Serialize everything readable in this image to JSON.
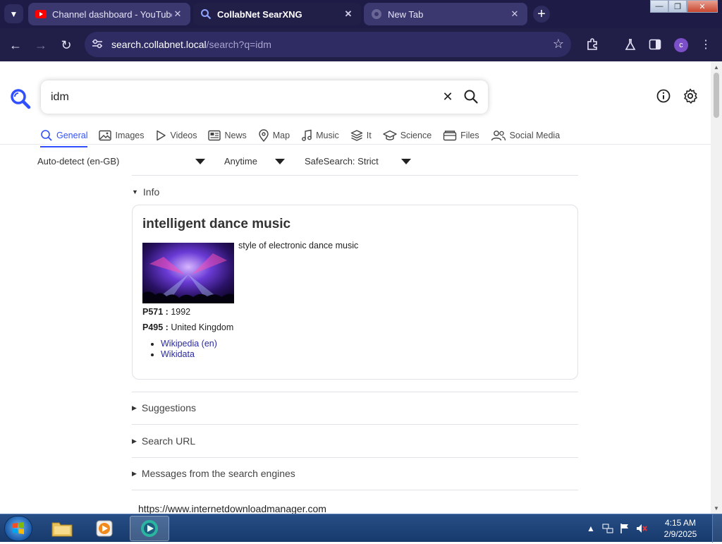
{
  "browser": {
    "tabs": [
      {
        "title": "Channel dashboard - YouTube",
        "favicon": "youtube-icon"
      },
      {
        "title": "CollabNet SearXNG",
        "favicon": "search-icon"
      },
      {
        "title": "New Tab",
        "favicon": "globe-icon"
      }
    ],
    "url_host": "search.collabnet.local",
    "url_path": "/search?q=idm",
    "profile_initial": "c"
  },
  "search": {
    "query": "idm"
  },
  "categories": [
    {
      "label": "General",
      "icon": "search-icon",
      "active": true
    },
    {
      "label": "Images",
      "icon": "image-icon"
    },
    {
      "label": "Videos",
      "icon": "play-icon"
    },
    {
      "label": "News",
      "icon": "newspaper-icon"
    },
    {
      "label": "Map",
      "icon": "map-pin-icon"
    },
    {
      "label": "Music",
      "icon": "music-note-icon"
    },
    {
      "label": "It",
      "icon": "layers-icon"
    },
    {
      "label": "Science",
      "icon": "graduation-cap-icon"
    },
    {
      "label": "Files",
      "icon": "files-icon"
    },
    {
      "label": "Social Media",
      "icon": "people-icon"
    }
  ],
  "filters": {
    "language": "Auto-detect (en-GB)",
    "time": "Anytime",
    "safesearch": "SafeSearch: Strict"
  },
  "info": {
    "section_label": "Info",
    "title": "intelligent dance music",
    "description": "style of electronic dance music",
    "attributes": [
      {
        "key": "P571 :",
        "value": "1992"
      },
      {
        "key": "P495 :",
        "value": "United Kingdom"
      }
    ],
    "links": [
      "Wikipedia (en)",
      "Wikidata"
    ]
  },
  "sections": {
    "suggestions": "Suggestions",
    "search_url": "Search URL",
    "engine_messages": "Messages from the search engines"
  },
  "result": {
    "url": "https://www.internetdownloadmanager.com"
  },
  "taskbar": {
    "time": "4:15 AM",
    "date": "2/9/2025"
  },
  "colors": {
    "accent": "#3050ff",
    "chrome_bg": "#211e48",
    "link": "#2a2aa0"
  }
}
